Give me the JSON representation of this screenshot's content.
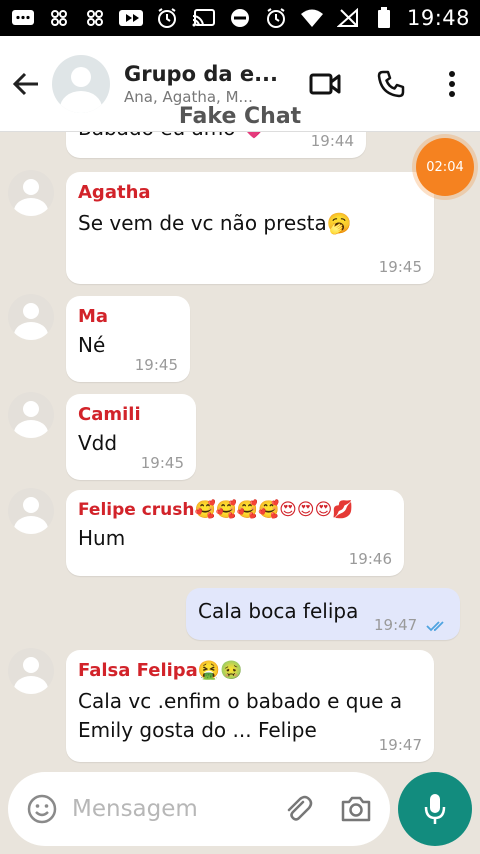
{
  "status_bar": {
    "time": "19:48"
  },
  "header": {
    "title": "Grupo da e...",
    "subtitle": "Ana, Agatha, M..."
  },
  "watermark": "Fake Chat",
  "timer_badge": "02:04",
  "messages": [
    {
      "sender": "",
      "text": "Babado eu amo 💗",
      "time": "19:44",
      "type": "in"
    },
    {
      "sender": "Agatha",
      "text": "Se vem de vc não presta🥱",
      "time": "19:45",
      "type": "in"
    },
    {
      "sender": "Ma",
      "text": "Né",
      "time": "19:45",
      "type": "in"
    },
    {
      "sender": "Camili",
      "text": "Vdd",
      "time": "19:45",
      "type": "in"
    },
    {
      "sender": "Felipe crush🥰🥰🥰🥰😍😍😍💋",
      "text": "Hum",
      "time": "19:46",
      "type": "in"
    },
    {
      "sender": "",
      "text": "Cala boca felipa",
      "time": "19:47",
      "type": "out"
    },
    {
      "sender": "Falsa Felipa🤮🤢",
      "text": "Cala vc .enfim o babado e que a Emily gosta do ... Felipe",
      "time": "19:47",
      "type": "in"
    }
  ],
  "composer": {
    "placeholder": "Mensagem"
  },
  "icons": {
    "back": "arrow-left-icon",
    "video": "video-call-icon",
    "phone": "phone-icon",
    "menu": "more-vert-icon",
    "emoji": "emoji-icon",
    "attach": "paperclip-icon",
    "camera": "camera-icon",
    "mic": "microphone-icon"
  },
  "colors": {
    "sender_name": "#d2232a",
    "outgoing_bubble": "#e2e7fb",
    "mic_button": "#128c7e",
    "timer_badge": "#f58220",
    "read_ticks": "#4fa3e0"
  }
}
